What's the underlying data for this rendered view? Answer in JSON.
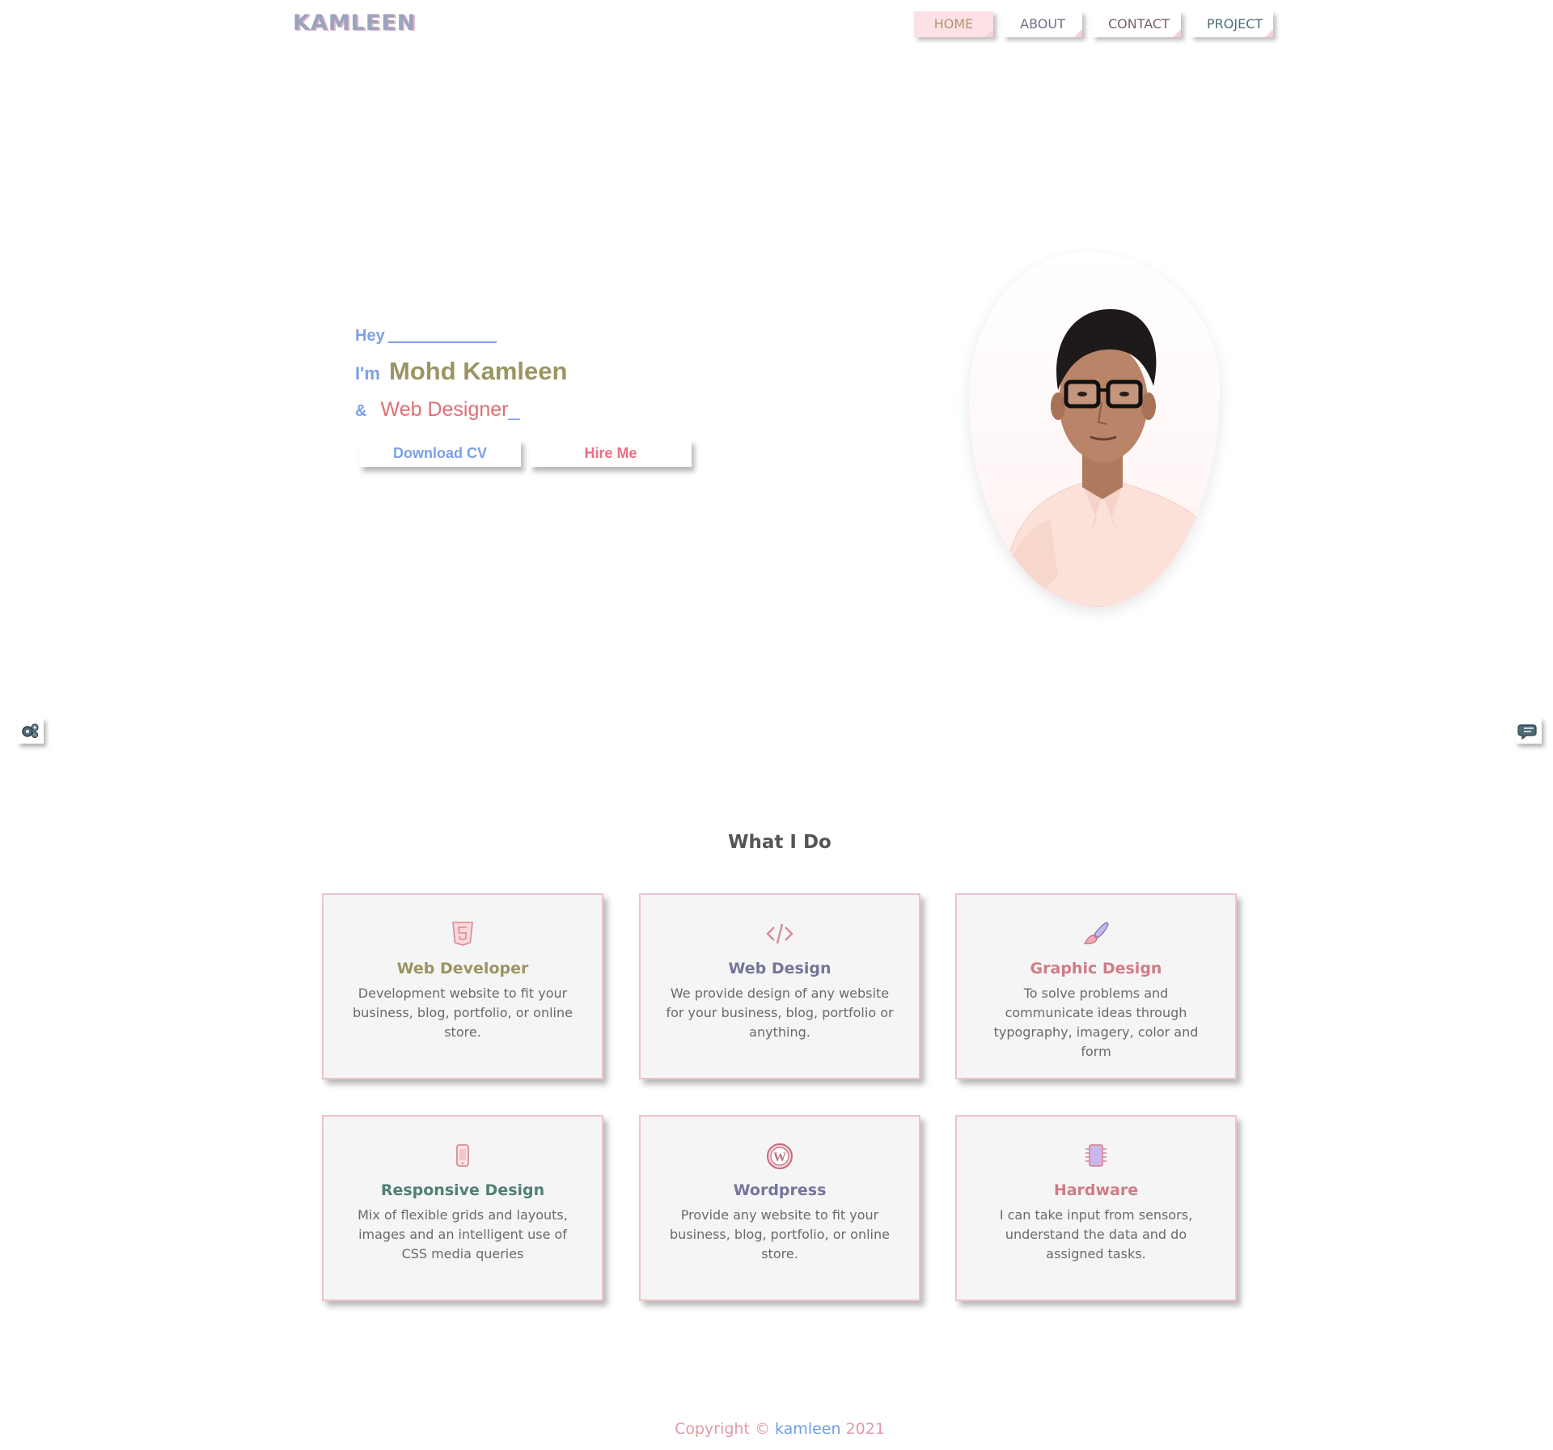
{
  "header": {
    "logo": "KAMLEEN",
    "nav": [
      {
        "label": "HOME",
        "active": true
      },
      {
        "label": "ABOUT",
        "active": false
      },
      {
        "label": "CONTACT",
        "active": false
      },
      {
        "label": "PROJECT",
        "active": false
      }
    ]
  },
  "hero": {
    "greeting": "Hey",
    "im": "I'm",
    "name": "Mohd Kamleen",
    "amp": "&",
    "role": "Web Designer",
    "cursor": "_",
    "download_cv_label": "Download CV",
    "hire_me_label": "Hire Me"
  },
  "side_buttons": {
    "left_icon": "settings-cogs-icon",
    "right_icon": "chat-bubbles-icon"
  },
  "services": {
    "title": "What I Do",
    "items": [
      {
        "icon": "html5-icon",
        "title": "Web Developer",
        "title_color": "#9a9562",
        "description": "Development website to fit your business, blog, portfolio, or online store."
      },
      {
        "icon": "code-icon",
        "title": "Web Design",
        "title_color": "#74759a",
        "description": "We provide design of any website for your business, blog, portfolio or anything."
      },
      {
        "icon": "paint-brush-icon",
        "title": "Graphic Design",
        "title_color": "#d07b86",
        "description": "To solve problems and communicate ideas through typography, imagery, color and form"
      },
      {
        "icon": "mobile-phone-icon",
        "title": "Responsive Design",
        "title_color": "#4f8075",
        "description": "Mix of flexible grids and layouts, images and an intelligent use of CSS media queries"
      },
      {
        "icon": "wordpress-icon",
        "title": "Wordpress",
        "title_color": "#74759a",
        "description": "Provide any website to fit your business, blog, portfolio, or online store."
      },
      {
        "icon": "microchip-icon",
        "title": "Hardware",
        "title_color": "#d07b86",
        "description": "I can take input from sensors, understand the data and do assigned tasks."
      }
    ]
  },
  "footer": {
    "prefix": "Copyright ©",
    "brand": "kamleen",
    "year": "2021"
  },
  "colors": {
    "accent_blue": "#7ca0e6",
    "accent_pink": "#ec6f82",
    "accent_olive": "#9a9562",
    "card_border": "#efc3c8",
    "nav_active_bg": "#fde1e6"
  }
}
